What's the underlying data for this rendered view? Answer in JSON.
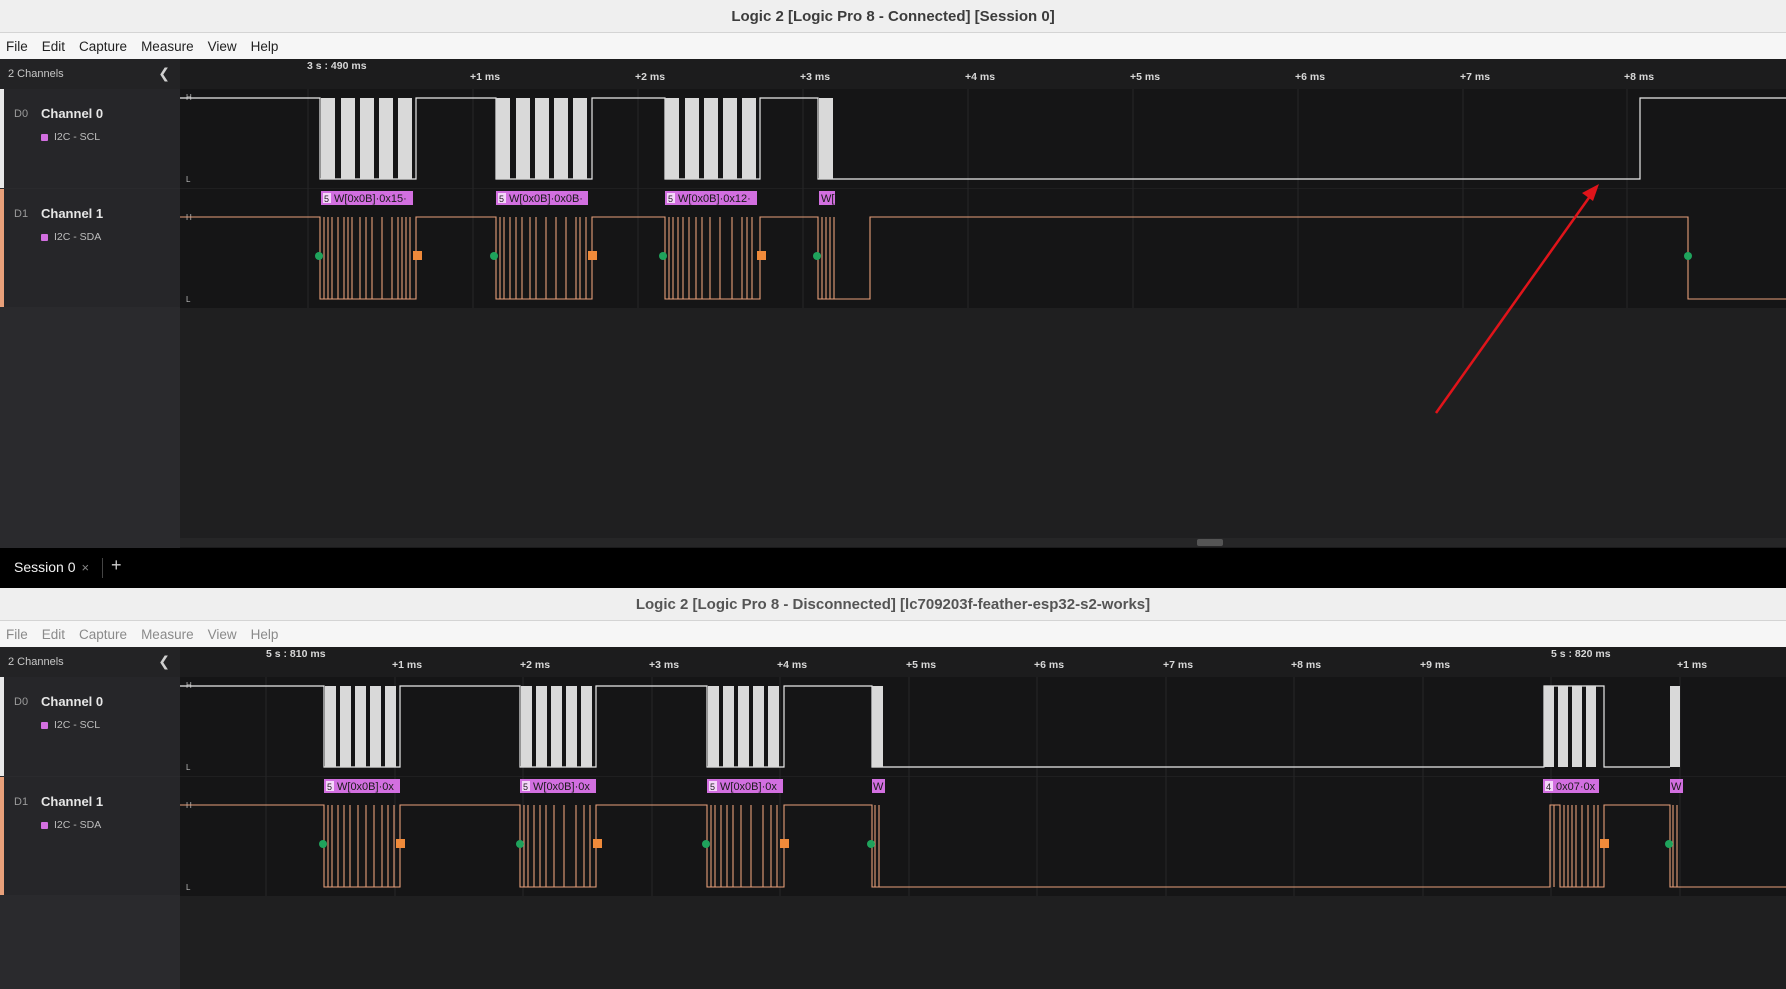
{
  "windows": [
    {
      "title": "Logic 2 [Logic Pro 8 - Connected] [Session 0]",
      "menu": [
        "File",
        "Edit",
        "Capture",
        "Measure",
        "View",
        "Help"
      ],
      "channels_header": "2 Channels",
      "start_label": "3 s : 490 ms",
      "ticks": [
        "+1 ms",
        "+2 ms",
        "+3 ms",
        "+4 ms",
        "+5 ms",
        "+6 ms",
        "+7 ms",
        "+8 ms"
      ],
      "channels": [
        {
          "index": "D0",
          "name": "Channel 0",
          "analyzer": "I2C - SCL"
        },
        {
          "index": "D1",
          "name": "Channel 1",
          "analyzer": "I2C - SDA"
        }
      ],
      "level_high": "H",
      "level_low": "L",
      "frames": [
        {
          "n": "5",
          "text": "W[0x0B]·0x15·"
        },
        {
          "n": "5",
          "text": "W[0x0B]·0x0B·"
        },
        {
          "n": "5",
          "text": "W[0x0B]·0x12·"
        },
        {
          "n": "",
          "text": "W["
        }
      ]
    },
    {
      "title": "Logic 2 [Logic Pro 8 - Disconnected] [lc709203f-feather-esp32-s2-works]",
      "menu": [
        "File",
        "Edit",
        "Capture",
        "Measure",
        "View",
        "Help"
      ],
      "channels_header": "2 Channels",
      "start_label": "5 s : 810 ms",
      "second_start_label": "5 s : 820 ms",
      "ticks": [
        "+1 ms",
        "+2 ms",
        "+3 ms",
        "+4 ms",
        "+5 ms",
        "+6 ms",
        "+7 ms",
        "+8 ms",
        "+9 ms",
        "+1 ms"
      ],
      "channels": [
        {
          "index": "D0",
          "name": "Channel 0",
          "analyzer": "I2C - SCL"
        },
        {
          "index": "D1",
          "name": "Channel 1",
          "analyzer": "I2C - SDA"
        }
      ],
      "level_high": "H",
      "level_low": "L",
      "frames": [
        {
          "n": "5",
          "text": "W[0x0B]·0x"
        },
        {
          "n": "5",
          "text": "W[0x0B]·0x"
        },
        {
          "n": "5",
          "text": "W[0x0B]·0x"
        },
        {
          "n": "",
          "text": "W"
        },
        {
          "n": "4",
          "text": "0x07·0x"
        },
        {
          "n": "",
          "text": "W"
        }
      ]
    }
  ],
  "session_tab": {
    "label": "Session 0",
    "close": "×",
    "add": "+"
  },
  "colors": {
    "accent_scl": "#e9e9e9",
    "accent_sda": "#e8a07a",
    "analyzer": "#d26fe0",
    "start": "#1fa35c",
    "stop": "#f08a3a",
    "arrow": "#e0141a"
  }
}
